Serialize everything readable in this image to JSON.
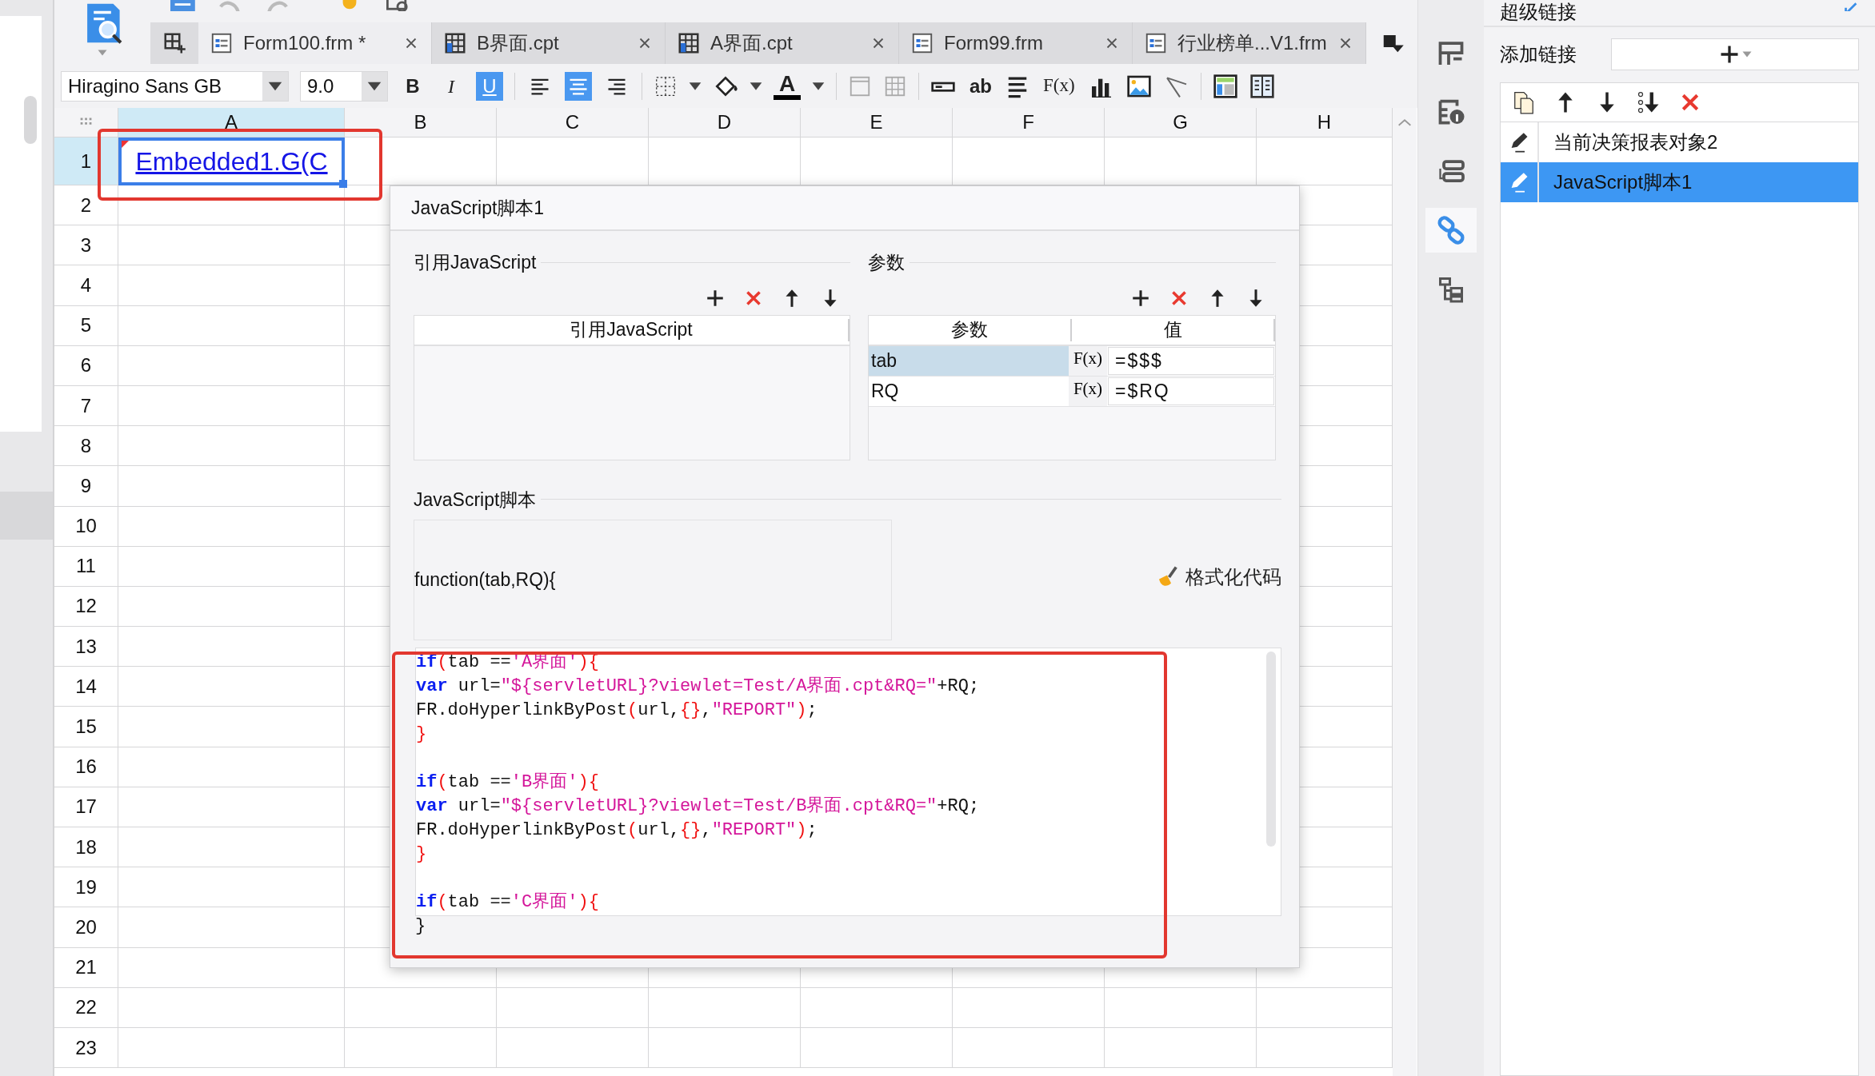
{
  "tabs": [
    {
      "label": "Form100.frm *",
      "kind": "form",
      "selected": true
    },
    {
      "label": "B界面.cpt",
      "kind": "report",
      "selected": false
    },
    {
      "label": "A界面.cpt",
      "kind": "report",
      "selected": false
    },
    {
      "label": "Form99.frm",
      "kind": "form",
      "selected": false
    },
    {
      "label": "行业榜单...V1.frm",
      "kind": "form",
      "selected": false
    }
  ],
  "format_toolbar": {
    "font": "Hiragino Sans GB",
    "size": "9.0",
    "style_buttons": [
      {
        "label": "B",
        "kind": "bold",
        "on": false
      },
      {
        "label": "I",
        "kind": "italic",
        "on": false
      },
      {
        "label": "U",
        "kind": "underline",
        "on": true
      }
    ],
    "align_buttons": [
      {
        "kind": "left",
        "on": false
      },
      {
        "kind": "center",
        "on": true
      },
      {
        "kind": "right",
        "on": false
      }
    ],
    "font_color_label": "A",
    "text_tool_label": "ab",
    "formula_label": "F(x)"
  },
  "grid": {
    "columns": [
      {
        "label": "A",
        "selected": true
      },
      {
        "label": "B",
        "selected": false
      },
      {
        "label": "C",
        "selected": false
      },
      {
        "label": "D",
        "selected": false
      },
      {
        "label": "E",
        "selected": false
      },
      {
        "label": "F",
        "selected": false
      },
      {
        "label": "G",
        "selected": false
      },
      {
        "label": "H",
        "selected": false
      }
    ],
    "rows": [
      {
        "label": "1",
        "selected": true
      },
      {
        "label": "2",
        "selected": false
      },
      {
        "label": "3",
        "selected": false
      },
      {
        "label": "4",
        "selected": false
      },
      {
        "label": "5",
        "selected": false
      },
      {
        "label": "6",
        "selected": false
      },
      {
        "label": "7",
        "selected": false
      },
      {
        "label": "8",
        "selected": false
      },
      {
        "label": "9",
        "selected": false
      },
      {
        "label": "10",
        "selected": false
      },
      {
        "label": "11",
        "selected": false
      },
      {
        "label": "12",
        "selected": false
      },
      {
        "label": "13",
        "selected": false
      },
      {
        "label": "14",
        "selected": false
      },
      {
        "label": "15",
        "selected": false
      },
      {
        "label": "16",
        "selected": false
      },
      {
        "label": "17",
        "selected": false
      },
      {
        "label": "18",
        "selected": false
      },
      {
        "label": "19",
        "selected": false
      },
      {
        "label": "20",
        "selected": false
      },
      {
        "label": "21",
        "selected": false
      },
      {
        "label": "22",
        "selected": false
      },
      {
        "label": "23",
        "selected": false
      }
    ],
    "cell_a1": "Embedded1.G(C"
  },
  "dialog": {
    "title": "JavaScript脚本1",
    "imports": {
      "legend": "引用JavaScript",
      "column": "引用JavaScript"
    },
    "parameters": {
      "legend": "参数",
      "columns": [
        "参数",
        "值"
      ],
      "rows": [
        {
          "name": "tab",
          "formula_button": "F(x)",
          "value": "=$$$",
          "selected": true
        },
        {
          "name": "RQ",
          "formula_button": "F(x)",
          "value": "=$RQ",
          "selected": false
        }
      ]
    },
    "script": {
      "legend": "JavaScript脚本",
      "header": "function(tab,RQ){",
      "format_button": "格式化代码",
      "footer": "}",
      "code_blocks": [
        [
          [
            {
              "kind": "kw",
              "text": "if"
            },
            {
              "kind": "br",
              "text": "("
            },
            {
              "kind": "tx",
              "text": "tab =="
            },
            {
              "kind": "str",
              "text": "'A界面'"
            },
            {
              "kind": "br",
              "text": "){"
            }
          ],
          [
            {
              "kind": "kw",
              "text": "var"
            },
            {
              "kind": "tx",
              "text": " url="
            },
            {
              "kind": "str",
              "text": "\"${servletURL}?viewlet=Test/A界面.cpt&RQ=\""
            },
            {
              "kind": "tx",
              "text": "+RQ;"
            }
          ],
          [
            {
              "kind": "tx",
              "text": "FR.doHyperlinkByPost"
            },
            {
              "kind": "br",
              "text": "("
            },
            {
              "kind": "tx",
              "text": "url,"
            },
            {
              "kind": "br",
              "text": "{}"
            },
            {
              "kind": "tx",
              "text": ","
            },
            {
              "kind": "str",
              "text": "\"REPORT\""
            },
            {
              "kind": "br",
              "text": ")"
            },
            {
              "kind": "tx",
              "text": ";"
            }
          ],
          [
            {
              "kind": "br",
              "text": "}"
            }
          ]
        ],
        [
          [
            {
              "kind": "kw",
              "text": "if"
            },
            {
              "kind": "br",
              "text": "("
            },
            {
              "kind": "tx",
              "text": "tab =="
            },
            {
              "kind": "str",
              "text": "'B界面'"
            },
            {
              "kind": "br",
              "text": "){"
            }
          ],
          [
            {
              "kind": "kw",
              "text": "var"
            },
            {
              "kind": "tx",
              "text": " url="
            },
            {
              "kind": "str",
              "text": "\"${servletURL}?viewlet=Test/B界面.cpt&RQ=\""
            },
            {
              "kind": "tx",
              "text": "+RQ;"
            }
          ],
          [
            {
              "kind": "tx",
              "text": "FR.doHyperlinkByPost"
            },
            {
              "kind": "br",
              "text": "("
            },
            {
              "kind": "tx",
              "text": "url,"
            },
            {
              "kind": "br",
              "text": "{}"
            },
            {
              "kind": "tx",
              "text": ","
            },
            {
              "kind": "str",
              "text": "\"REPORT\""
            },
            {
              "kind": "br",
              "text": ")"
            },
            {
              "kind": "tx",
              "text": ";"
            }
          ],
          [
            {
              "kind": "br",
              "text": "}"
            }
          ]
        ],
        [
          [
            {
              "kind": "kw",
              "text": "if"
            },
            {
              "kind": "br",
              "text": "("
            },
            {
              "kind": "tx",
              "text": "tab =="
            },
            {
              "kind": "str",
              "text": "'C界面'"
            },
            {
              "kind": "br",
              "text": "){"
            }
          ]
        ]
      ]
    }
  },
  "side_tools": [
    {
      "kind": "layout",
      "selected": false
    },
    {
      "kind": "info",
      "selected": false
    },
    {
      "kind": "widget",
      "selected": false
    },
    {
      "kind": "link",
      "selected": true
    },
    {
      "kind": "tree",
      "selected": false
    }
  ],
  "hyperlink_panel": {
    "title": "超级链接",
    "add_label": "添加链接",
    "items": [
      {
        "label": "当前决策报表对象2",
        "selected": false
      },
      {
        "label": "JavaScript脚本1",
        "selected": true
      }
    ]
  }
}
